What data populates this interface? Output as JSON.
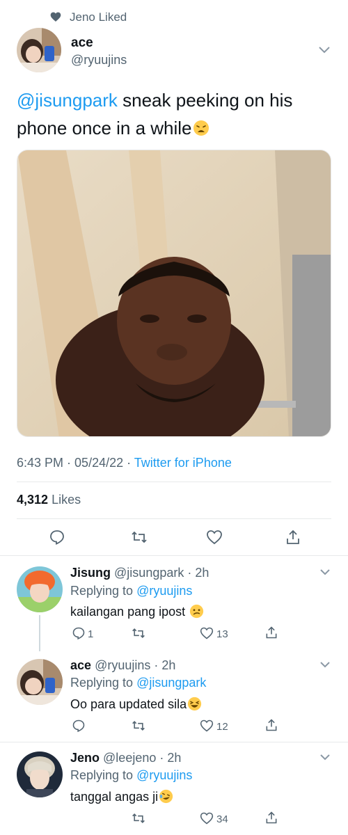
{
  "social_context": {
    "text": "Jeno Liked"
  },
  "tweet": {
    "author_name": "ace",
    "author_handle": "@ryuujins",
    "mention": "@jisungpark",
    "text": " sneak peeking on his phone once in a while",
    "time": "6:43 PM",
    "date": "05/24/22",
    "source": "Twitter for iPhone",
    "likes_count": "4,312",
    "likes_label": "Likes"
  },
  "replies": [
    {
      "name": "Jisung",
      "handle": "@jisungpark",
      "time": "2h",
      "replying_label": "Replying to",
      "replying_to": "@ryuujins",
      "text": "kailangan pang ipost",
      "reply_count": "1",
      "like_count": "13"
    },
    {
      "name": "ace",
      "handle": "@ryuujins",
      "time": "2h",
      "replying_label": "Replying to",
      "replying_to": "@jisungpark",
      "text": "Oo para updated sila",
      "reply_count": "",
      "like_count": "12"
    },
    {
      "name": "Jeno",
      "handle": "@leejeno",
      "time": "2h",
      "replying_label": "Replying to",
      "replying_to": "@ryuujins",
      "text": "tanggal angas ji",
      "reply_count": "",
      "like_count": "34"
    }
  ],
  "colors": {
    "accent": "#1d9bf0",
    "secondary_text": "#536471",
    "divider": "#e7e9ea"
  }
}
